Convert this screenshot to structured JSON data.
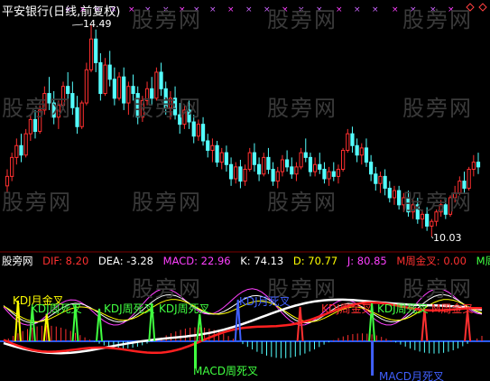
{
  "title": "平安银行(日线,前复权)",
  "watermark": "股旁网",
  "price_panel": {
    "high_label": "14.49",
    "low_label": "10.03"
  },
  "indicator": {
    "name": "股旁网",
    "values": [
      {
        "label": "DIF: 8.20",
        "color": "#ff3030"
      },
      {
        "label": "DEA: -3.28",
        "color": "#ffffff"
      },
      {
        "label": "MACD: 22.96",
        "color": "#ff40ff"
      },
      {
        "label": "K: 74.13",
        "color": "#ffffff"
      },
      {
        "label": "D: 70.77",
        "color": "#ffff00"
      },
      {
        "label": "J: 80.85",
        "color": "#ff40ff"
      },
      {
        "label": "M周金叉: 0.00",
        "color": "#ff3030"
      },
      {
        "label": "M周死叉",
        "color": "#40ff40"
      }
    ],
    "signals": [
      {
        "text": "KDJ月金叉",
        "color": "#ffff00"
      },
      {
        "text": "KDJ周死叉",
        "color": "#40ff40"
      },
      {
        "text": "KDJ周死叉",
        "color": "#40ff40"
      },
      {
        "text": "KDJ周死叉",
        "color": "#40ff40"
      },
      {
        "text": "KDJ月死叉",
        "color": "#4060ff"
      },
      {
        "text": "KDJ周金叉",
        "color": "#ff3030"
      },
      {
        "text": "KDJ周死叉",
        "color": "#40ff40"
      },
      {
        "text": "M周金叉",
        "color": "#ff3030"
      },
      {
        "text": "MACD周死叉",
        "color": "#40ff40"
      },
      {
        "text": "MACD月死叉",
        "color": "#4060ff"
      }
    ]
  },
  "chart_data": {
    "type": "candlestick",
    "title": "平安银行(日线,前复权)",
    "annotations": [
      {
        "text": "14.49",
        "meaning": "period high"
      },
      {
        "text": "10.03",
        "meaning": "period low"
      }
    ],
    "ohlc": [
      [
        11.1,
        11.45,
        10.95,
        11.3
      ],
      [
        11.3,
        11.8,
        11.2,
        11.7
      ],
      [
        11.7,
        12.1,
        11.55,
        11.95
      ],
      [
        11.95,
        12.2,
        11.6,
        11.75
      ],
      [
        11.75,
        12.3,
        11.7,
        12.2
      ],
      [
        12.2,
        12.6,
        12.05,
        12.5
      ],
      [
        12.5,
        12.7,
        12.1,
        12.25
      ],
      [
        12.25,
        12.8,
        12.2,
        12.7
      ],
      [
        12.7,
        13.2,
        12.6,
        13.05
      ],
      [
        13.05,
        13.4,
        12.7,
        12.85
      ],
      [
        12.85,
        13.1,
        12.4,
        12.55
      ],
      [
        12.55,
        12.9,
        12.3,
        12.8
      ],
      [
        12.8,
        13.3,
        12.7,
        13.2
      ],
      [
        13.2,
        13.5,
        12.9,
        13.05
      ],
      [
        13.05,
        13.3,
        12.6,
        12.75
      ],
      [
        12.75,
        13.0,
        12.2,
        12.35
      ],
      [
        12.35,
        12.9,
        12.3,
        12.85
      ],
      [
        12.85,
        13.7,
        12.8,
        13.55
      ],
      [
        13.55,
        14.49,
        13.5,
        14.2
      ],
      [
        14.2,
        14.4,
        13.5,
        13.7
      ],
      [
        13.7,
        13.9,
        12.9,
        13.05
      ],
      [
        13.05,
        13.8,
        13.0,
        13.65
      ],
      [
        13.65,
        13.95,
        13.2,
        13.35
      ],
      [
        13.35,
        13.6,
        12.8,
        12.95
      ],
      [
        12.95,
        13.5,
        12.9,
        13.4
      ],
      [
        13.4,
        13.6,
        12.7,
        12.85
      ],
      [
        12.85,
        13.3,
        12.6,
        13.2
      ],
      [
        13.2,
        13.45,
        12.9,
        13.05
      ],
      [
        13.05,
        13.2,
        12.4,
        12.55
      ],
      [
        12.55,
        13.0,
        12.45,
        12.9
      ],
      [
        12.9,
        13.3,
        12.8,
        13.15
      ],
      [
        13.15,
        13.4,
        12.8,
        12.95
      ],
      [
        12.95,
        13.6,
        12.9,
        13.5
      ],
      [
        13.5,
        13.7,
        13.0,
        13.15
      ],
      [
        13.15,
        13.3,
        12.6,
        12.75
      ],
      [
        12.75,
        13.1,
        12.5,
        12.95
      ],
      [
        12.95,
        13.2,
        12.5,
        12.6
      ],
      [
        12.6,
        12.85,
        12.2,
        12.4
      ],
      [
        12.4,
        12.8,
        12.3,
        12.7
      ],
      [
        12.7,
        12.9,
        12.3,
        12.45
      ],
      [
        12.45,
        12.6,
        12.0,
        12.15
      ],
      [
        12.15,
        12.5,
        12.05,
        12.4
      ],
      [
        12.4,
        12.55,
        11.95,
        12.05
      ],
      [
        12.05,
        12.2,
        11.7,
        11.85
      ],
      [
        11.85,
        12.1,
        11.6,
        11.95
      ],
      [
        11.95,
        12.05,
        11.5,
        11.6
      ],
      [
        11.6,
        11.9,
        11.45,
        11.8
      ],
      [
        11.8,
        11.95,
        11.4,
        11.55
      ],
      [
        11.55,
        11.7,
        11.1,
        11.25
      ],
      [
        11.25,
        11.6,
        11.15,
        11.5
      ],
      [
        11.5,
        11.65,
        11.05,
        11.2
      ],
      [
        11.2,
        11.55,
        11.1,
        11.45
      ],
      [
        11.45,
        11.9,
        11.4,
        11.8
      ],
      [
        11.8,
        12.0,
        11.4,
        11.55
      ],
      [
        11.55,
        11.7,
        11.2,
        11.35
      ],
      [
        11.35,
        11.8,
        11.3,
        11.7
      ],
      [
        11.7,
        11.9,
        11.35,
        11.45
      ],
      [
        11.45,
        11.6,
        11.1,
        11.2
      ],
      [
        11.2,
        11.5,
        11.05,
        11.4
      ],
      [
        11.4,
        11.75,
        11.3,
        11.65
      ],
      [
        11.65,
        11.85,
        11.4,
        11.5
      ],
      [
        11.5,
        11.7,
        11.25,
        11.35
      ],
      [
        11.35,
        11.6,
        11.2,
        11.5
      ],
      [
        11.5,
        11.9,
        11.45,
        11.8
      ],
      [
        11.8,
        12.1,
        11.6,
        11.7
      ],
      [
        11.7,
        11.8,
        11.3,
        11.4
      ],
      [
        11.4,
        11.7,
        11.3,
        11.55
      ],
      [
        11.55,
        11.8,
        11.35,
        11.45
      ],
      [
        11.45,
        11.6,
        11.15,
        11.25
      ],
      [
        11.25,
        11.5,
        11.1,
        11.4
      ],
      [
        11.4,
        11.6,
        11.2,
        11.3
      ],
      [
        11.3,
        11.55,
        11.15,
        11.45
      ],
      [
        11.45,
        11.9,
        11.4,
        11.85
      ],
      [
        11.85,
        12.3,
        11.8,
        12.2
      ],
      [
        12.2,
        12.35,
        11.8,
        11.95
      ],
      [
        11.95,
        12.1,
        11.6,
        11.75
      ],
      [
        11.75,
        12.0,
        11.55,
        11.9
      ],
      [
        11.9,
        12.1,
        11.5,
        11.6
      ],
      [
        11.6,
        11.75,
        11.2,
        11.35
      ],
      [
        11.35,
        11.5,
        11.0,
        11.15
      ],
      [
        11.15,
        11.4,
        10.95,
        11.3
      ],
      [
        11.3,
        11.45,
        10.9,
        11.05
      ],
      [
        11.05,
        11.2,
        10.75,
        10.85
      ],
      [
        10.85,
        11.1,
        10.7,
        11.0
      ],
      [
        11.0,
        11.1,
        10.6,
        10.7
      ],
      [
        10.7,
        10.95,
        10.55,
        10.85
      ],
      [
        10.85,
        11.0,
        10.45,
        10.55
      ],
      [
        10.55,
        10.8,
        10.4,
        10.7
      ],
      [
        10.7,
        10.85,
        10.3,
        10.4
      ],
      [
        10.4,
        10.6,
        10.2,
        10.5
      ],
      [
        10.5,
        10.65,
        10.15,
        10.25
      ],
      [
        10.25,
        10.4,
        10.03,
        10.35
      ],
      [
        10.35,
        10.6,
        10.25,
        10.55
      ],
      [
        10.55,
        10.8,
        10.45,
        10.7
      ],
      [
        10.7,
        10.85,
        10.4,
        10.5
      ],
      [
        10.5,
        10.9,
        10.45,
        10.85
      ],
      [
        10.85,
        11.1,
        10.75,
        10.95
      ],
      [
        10.95,
        11.3,
        10.9,
        11.2
      ],
      [
        11.2,
        11.4,
        10.95,
        11.05
      ],
      [
        11.05,
        11.5,
        11.0,
        11.45
      ],
      [
        11.45,
        11.75,
        11.3,
        11.6
      ],
      [
        11.6,
        11.8,
        11.35,
        11.5
      ]
    ],
    "colors": {
      "up": "#ff3030",
      "down": "#54ffff"
    }
  }
}
